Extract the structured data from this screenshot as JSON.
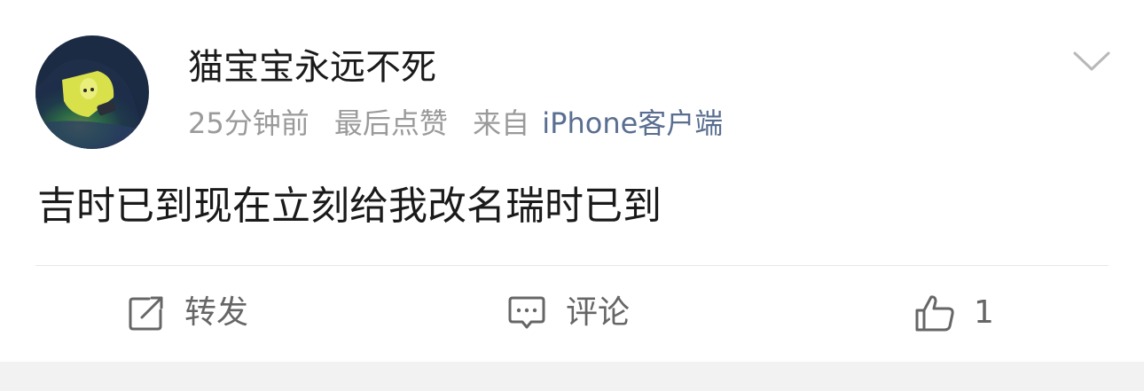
{
  "post": {
    "username": "猫宝宝永远不死",
    "time": "25分钟前",
    "last_action": "最后点赞",
    "source_prefix": "来自",
    "source": "iPhone客户端",
    "content": "吉时已到现在立刻给我改名瑞时已到"
  },
  "actions": {
    "repost_label": "转发",
    "comment_label": "评论",
    "like_count": "1"
  },
  "icons": {
    "more": "chevron-down-icon",
    "repost": "share-square-icon",
    "comment": "comment-bubble-icon",
    "like": "thumbs-up-icon"
  },
  "colors": {
    "text_primary": "#1a1a1a",
    "text_secondary": "#9a9a9a",
    "source_link": "#5a6e91",
    "action_text": "#666666",
    "divider": "#e8e8e8",
    "bottom_bar": "#f2f2f2"
  }
}
